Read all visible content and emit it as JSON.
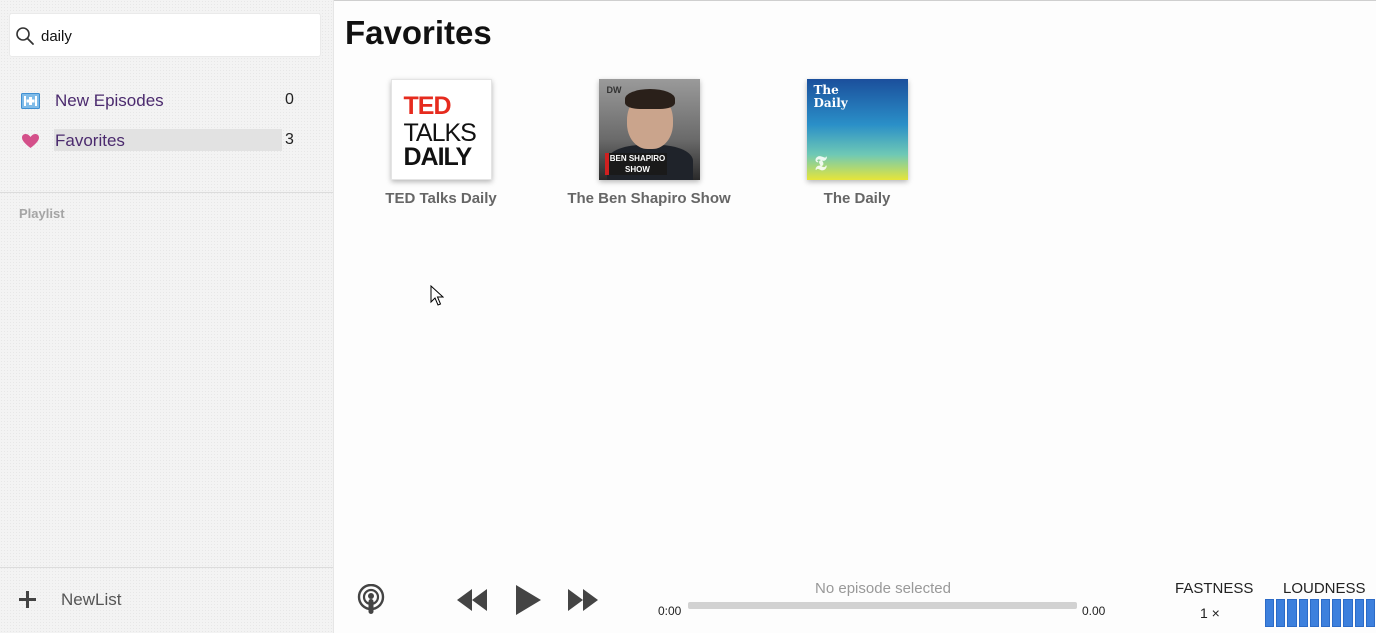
{
  "search": {
    "value": "daily"
  },
  "nav": {
    "new_episodes": {
      "label": "New Episodes",
      "count": "0"
    },
    "favorites": {
      "label": "Favorites",
      "count": "3"
    }
  },
  "playlist_section": {
    "title": "Playlist"
  },
  "newlist": {
    "label": "NewList"
  },
  "main": {
    "title": "Favorites",
    "podcasts": [
      {
        "title": "TED Talks Daily",
        "cover_lines": [
          "TED",
          "TALKS",
          "DAILY"
        ]
      },
      {
        "title": "The Ben Shapiro Show",
        "cover_text": "DW",
        "cover_badge": "BEN SHAPIRO SHOW"
      },
      {
        "title": "The Daily",
        "cover_lines": [
          "The",
          "Daily"
        ]
      }
    ]
  },
  "player": {
    "now_playing": "No episode selected",
    "time_current": "0:00",
    "time_total": "0.00",
    "progress": 0,
    "fastness_label": "FASTNESS",
    "speed_value": "1 ×",
    "loudness_label": "LOUDNESS",
    "volume_level": 1.0,
    "icons": [
      "podcast-icon",
      "rewind-icon",
      "play-icon",
      "fast-forward-icon"
    ]
  },
  "colors": {
    "accent_purple": "#4b2a6e",
    "heart_pink": "#d4508a",
    "volume_blue": "#3d80dd",
    "ted_red": "#e62b1e"
  }
}
